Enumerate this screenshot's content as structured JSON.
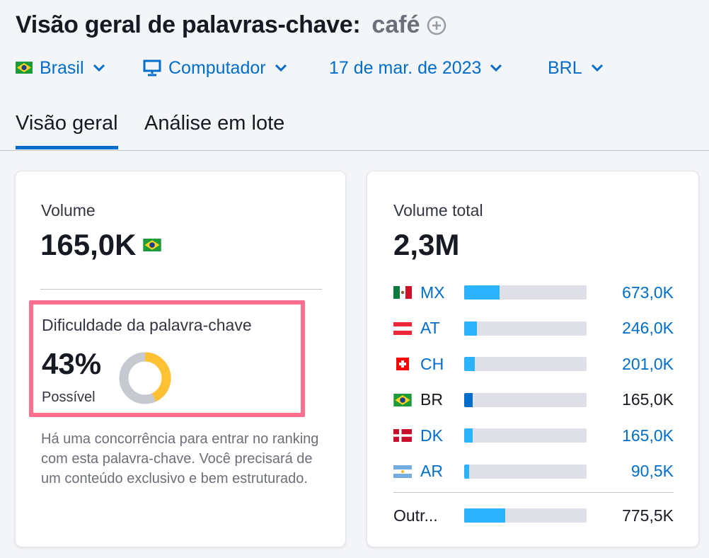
{
  "header": {
    "title": "Visão geral de palavras-chave:",
    "keyword": "café"
  },
  "filters": {
    "country": "Brasil",
    "device": "Computador",
    "date": "17 de mar. de 2023",
    "currency": "BRL"
  },
  "tabs": [
    {
      "label": "Visão geral",
      "active": true
    },
    {
      "label": "Análise em lote",
      "active": false
    }
  ],
  "volume": {
    "label": "Volume",
    "value": "165,0K"
  },
  "difficulty": {
    "label": "Dificuldade da palavra-chave",
    "value": "43%",
    "percent": 43,
    "level": "Possível",
    "description": "Há uma concorrência para entrar no ranking com esta palavra-chave. Você precisará de um conteúdo exclusivo e bem estruturado.",
    "colors": {
      "fill": "#ffc134",
      "track": "#c7c9d1"
    }
  },
  "total_volume": {
    "label": "Volume total",
    "value": "2,3M",
    "countries": [
      {
        "code": "MX",
        "value": "673,0K",
        "share": 0.29,
        "flag": "mexico-flag",
        "link": true
      },
      {
        "code": "AT",
        "value": "246,0K",
        "share": 0.105,
        "flag": "austria-flag",
        "link": true
      },
      {
        "code": "CH",
        "value": "201,0K",
        "share": 0.087,
        "flag": "switzerland-flag",
        "link": true
      },
      {
        "code": "BR",
        "value": "165,0K",
        "share": 0.071,
        "flag": "brazil-flag",
        "link": false,
        "current": true
      },
      {
        "code": "DK",
        "value": "165,0K",
        "share": 0.071,
        "flag": "denmark-flag",
        "link": true
      },
      {
        "code": "AR",
        "value": "90,5K",
        "share": 0.039,
        "flag": "argentina-flag",
        "link": true
      }
    ],
    "other": {
      "code": "Outr...",
      "value": "775,5K",
      "share": 0.335
    }
  },
  "colors": {
    "link": "#006dca",
    "bar_fill": "#2bb3ff",
    "bar_current": "#006dca",
    "bar_track": "#dfe0e7",
    "highlight": "#ff6f8f"
  }
}
